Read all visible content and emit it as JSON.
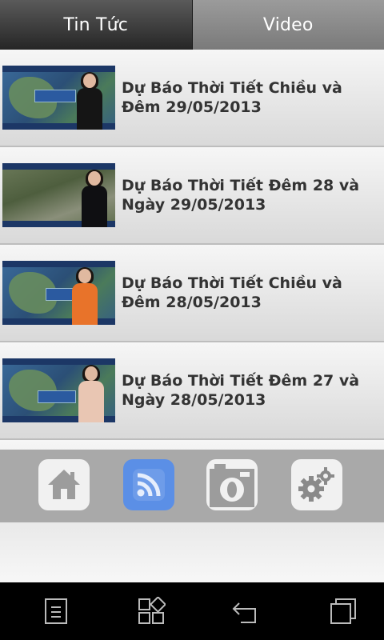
{
  "tabs": [
    {
      "label": "Tin Tức",
      "active": true
    },
    {
      "label": "Video",
      "active": false
    }
  ],
  "videos": [
    {
      "title": "Dự Báo Thời Tiết Chiều và Đêm 29/05/2013"
    },
    {
      "title": "Dự Báo Thời Tiết Đêm 28 và Ngày 29/05/2013"
    },
    {
      "title": "Dự Báo Thời Tiết Chiều và Đêm 28/05/2013"
    },
    {
      "title": "Dự Báo Thời Tiết Đêm 27 và Ngày 28/05/2013"
    }
  ],
  "dock": {
    "items": [
      {
        "icon": "home-icon"
      },
      {
        "icon": "rss-icon",
        "active": true
      },
      {
        "icon": "camera-icon"
      },
      {
        "icon": "settings-gears-icon"
      }
    ],
    "active_color": "#5b8fe6"
  },
  "system_nav": {
    "items": [
      {
        "icon": "menu-icon"
      },
      {
        "icon": "apps-grid-icon"
      },
      {
        "icon": "back-icon"
      },
      {
        "icon": "recent-apps-icon"
      }
    ]
  }
}
